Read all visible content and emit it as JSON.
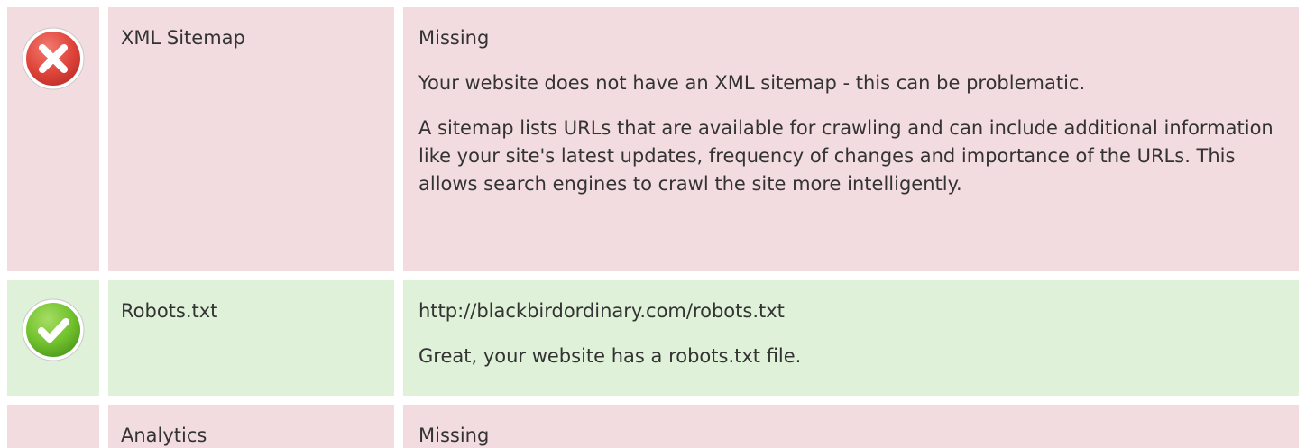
{
  "rows": [
    {
      "status": "error",
      "label": "XML Sitemap",
      "lines": [
        "Missing",
        "Your website does not have an XML sitemap - this can be problematic.",
        "A sitemap lists URLs that are available for crawling and can include additional information like your site's latest updates, frequency of changes and importance of the URLs. This allows search engines to crawl the site more intelligently."
      ],
      "icon": "error-x-icon"
    },
    {
      "status": "pass",
      "label": "Robots.txt",
      "lines": [
        "http://blackbirdordinary.com/robots.txt",
        "Great, your website has a robots.txt file."
      ],
      "icon": "check-icon"
    },
    {
      "status": "error",
      "label": "Analytics",
      "lines": [
        "Missing"
      ]
    }
  ],
  "colors": {
    "error_bg": "#f2dcdf",
    "pass_bg": "#dff1d8",
    "error_icon": "#e04a42",
    "pass_icon": "#72c22e"
  }
}
